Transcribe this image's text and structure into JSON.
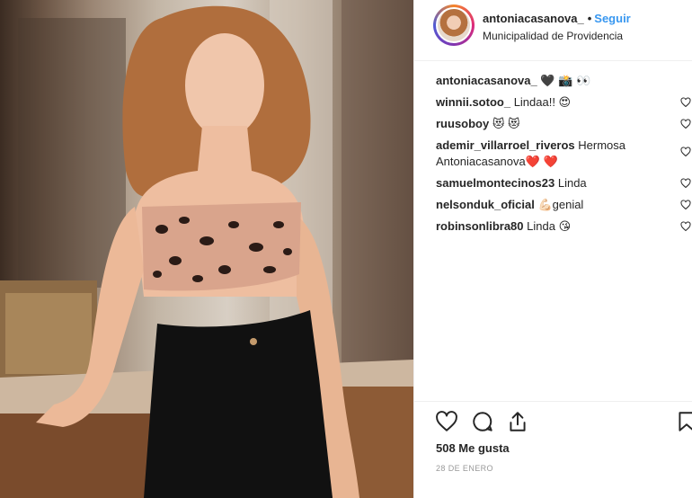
{
  "header": {
    "username": "antoniacasanova_",
    "separator": "•",
    "follow_label": "Seguir",
    "location": "Municipalidad de Providencia"
  },
  "comments": [
    {
      "user": "antoniacasanova_",
      "text": "🖤 📸 👀",
      "likeable": false
    },
    {
      "user": "winnii.sotoo_",
      "text": "Lindaa!! 😍",
      "likeable": true
    },
    {
      "user": "ruusoboy",
      "text": "😻 😻",
      "likeable": true
    },
    {
      "user": "ademir_villarroel_riveros",
      "text": "Hermosa Antoniacasanova❤️ ❤️",
      "likeable": true
    },
    {
      "user": "samuelmontecinos23",
      "text": "Linda",
      "likeable": true
    },
    {
      "user": "nelsonduk_oficial",
      "text": "💪🏻genial",
      "likeable": true
    },
    {
      "user": "robinsonlibra80",
      "text": "Linda 😘",
      "likeable": true
    }
  ],
  "footer": {
    "likes": "508 Me gusta",
    "date": "28 DE ENERO"
  },
  "icons": {
    "like": "heart-outline-icon",
    "comment": "speech-bubble-icon",
    "share": "share-arrow-icon",
    "save": "bookmark-icon"
  },
  "colors": {
    "follow": "#3897f0",
    "text": "#262626",
    "muted": "#999999",
    "divider": "#efefef"
  }
}
